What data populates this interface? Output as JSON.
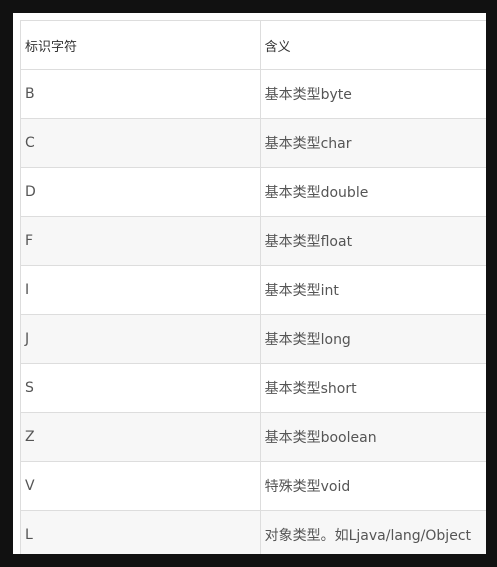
{
  "table": {
    "headers": [
      "标识字符",
      "含义"
    ],
    "rows": [
      [
        "B",
        "基本类型byte"
      ],
      [
        "C",
        "基本类型char"
      ],
      [
        "D",
        "基本类型double"
      ],
      [
        "F",
        "基本类型float"
      ],
      [
        "I",
        "基本类型int"
      ],
      [
        "J",
        "基本类型long"
      ],
      [
        "S",
        "基本类型short"
      ],
      [
        "Z",
        "基本类型boolean"
      ],
      [
        "V",
        "特殊类型void"
      ],
      [
        "L",
        "对象类型。如Ljava/lang/Object"
      ]
    ]
  }
}
